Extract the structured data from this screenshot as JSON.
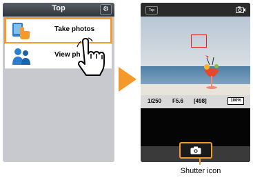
{
  "left_screen": {
    "title": "Top",
    "gear_icon": "gear-icon",
    "menu": [
      {
        "label": "Take photos",
        "icon": "take-photos-icon",
        "selected": true
      },
      {
        "label": "View ph",
        "icon": "view-photos-icon",
        "selected": false
      }
    ]
  },
  "arrow_icon": "right-arrow-icon",
  "right_screen": {
    "top_button": "Top",
    "camera_switch_icon": "camera-switch-icon",
    "info": {
      "shutter_speed": "1/250",
      "aperture": "F5.6",
      "shots": "[498]",
      "battery": "100%"
    },
    "shutter_icon": "camera-icon"
  },
  "caption": "Shutter icon",
  "colors": {
    "accent": "#f39a2a",
    "focus_box": "#e21e1e"
  }
}
